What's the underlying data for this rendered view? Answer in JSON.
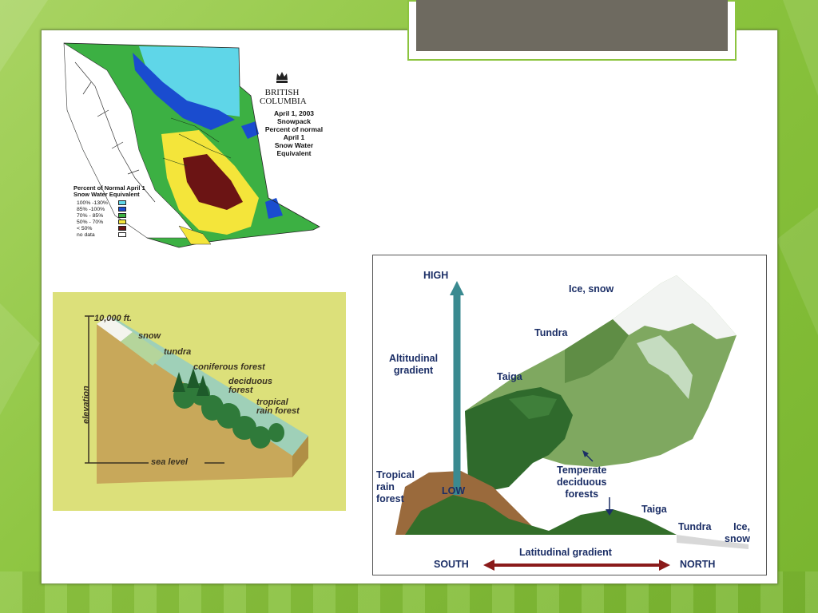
{
  "map": {
    "logo_top": "BRITISH",
    "logo_bottom": "COLUMBIA",
    "title": "April 1, 2003\nSnowpack\nPercent of normal April 1\nSnow Water Equivalent",
    "legend_title": "Percent of Normal April 1 Snow Water Equivalent",
    "legend": [
      {
        "label": "100% -130%",
        "color": "#5fd6e8"
      },
      {
        "label": "85% -100%",
        "color": "#1a4ccf"
      },
      {
        "label": "70% - 85%",
        "color": "#3cb043"
      },
      {
        "label": "50% - 70%",
        "color": "#f4e53a"
      },
      {
        "label": "< 50%",
        "color": "#6b1414"
      },
      {
        "label": "no data",
        "color": "#ffffff"
      }
    ]
  },
  "elevation": {
    "top": "10,000 ft.",
    "axis": "elevation",
    "bottom": "sea level",
    "zones": [
      "snow",
      "tundra",
      "coniferous forest",
      "deciduous\nforest",
      "tropical\nrain forest"
    ]
  },
  "gradient": {
    "high": "HIGH",
    "low": "LOW",
    "altitudinal": "Altitudinal\ngradient",
    "ice_snow_top": "Ice, snow",
    "tundra_top": "Tundra",
    "taiga_top": "Taiga",
    "tropical": "Tropical\nrain\nforest",
    "temperate": "Temperate\ndeciduous\nforests",
    "taiga_bottom": "Taiga",
    "tundra_bottom": "Tundra",
    "ice_snow_bottom": "Ice,\nsnow",
    "latitudinal": "Latitudinal gradient",
    "south": "SOUTH",
    "north": "NORTH"
  }
}
